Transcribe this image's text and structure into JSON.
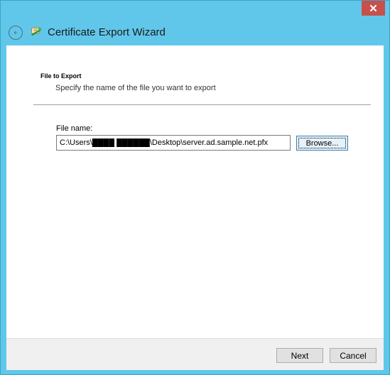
{
  "window": {
    "title": "Certificate Export Wizard",
    "close_glyph": "✕",
    "close_color": "#c7504a",
    "frame_color": "#61c7ea"
  },
  "header": {
    "back_icon": "back-arrow-icon",
    "wizard_icon": "certificate-wizard-icon"
  },
  "page": {
    "section_title": "File to Export",
    "section_description": "Specify the name of the file you want to export"
  },
  "form": {
    "file_name_label": "File name:",
    "file_name_value": "C:\\Users\\████ ██████\\Desktop\\server.ad.sample.net.pfx",
    "browse_label": "Browse..."
  },
  "footer": {
    "next_label": "Next",
    "cancel_label": "Cancel"
  }
}
